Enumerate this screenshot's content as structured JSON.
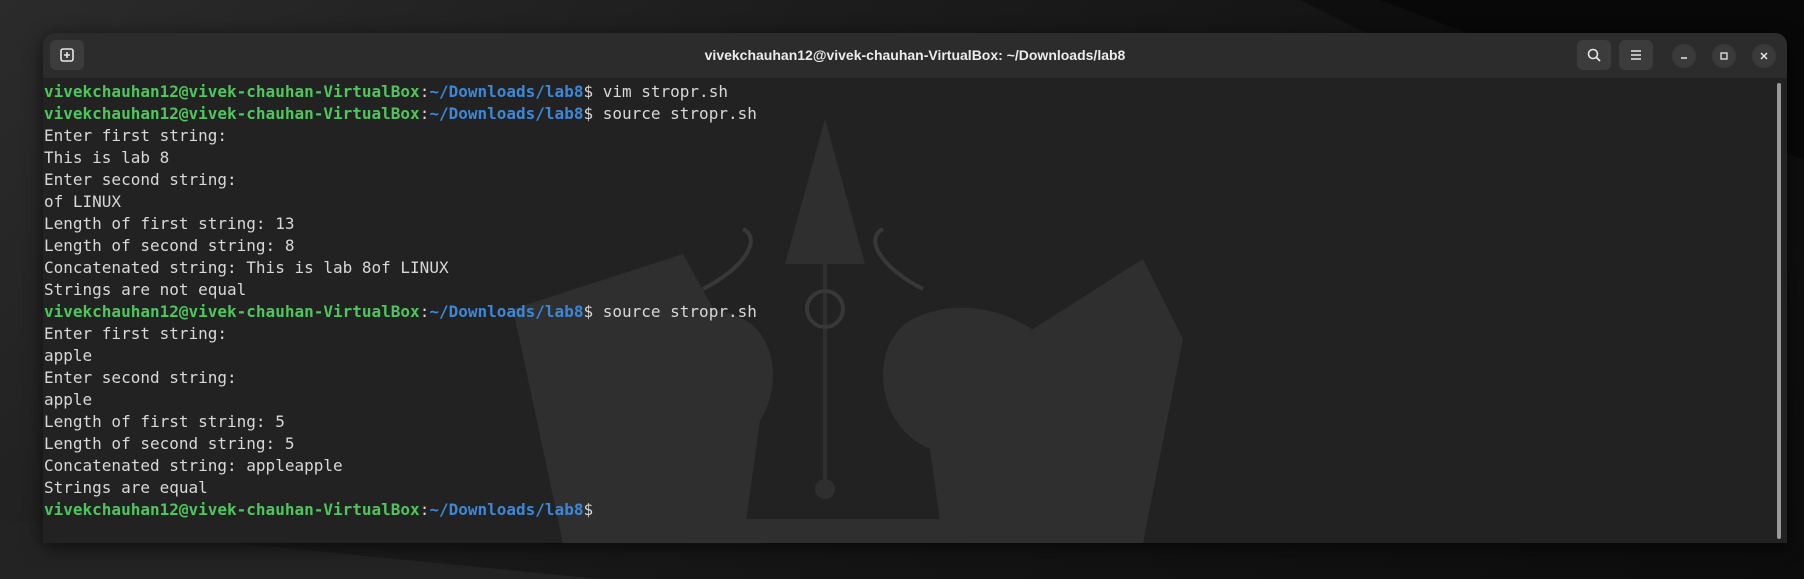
{
  "window": {
    "title": "vivekchauhan12@vivek-chauhan-VirtualBox: ~/Downloads/lab8"
  },
  "toolbar": {
    "new_tab_icon": "new-tab-icon",
    "search_icon": "search-icon",
    "menu_icon": "hamburger-menu-icon"
  },
  "window_controls": [
    "minimize-icon",
    "maximize-icon",
    "close-icon"
  ],
  "prompt": {
    "user_host": "vivekchauhan12@vivek-chauhan-VirtualBox",
    "separator": ":",
    "path": "~/Downloads/lab8",
    "symbol": "$"
  },
  "colors": {
    "prompt_user": "#4fc65d",
    "prompt_path": "#3d87d8",
    "text": "#d8d8d8",
    "background": "#222222"
  },
  "lines": [
    {
      "type": "prompt",
      "command": " vim stropr.sh"
    },
    {
      "type": "prompt",
      "command": " source stropr.sh"
    },
    {
      "type": "output",
      "text": "Enter first string:"
    },
    {
      "type": "output",
      "text": "This is lab 8"
    },
    {
      "type": "output",
      "text": "Enter second string:"
    },
    {
      "type": "output",
      "text": "of LINUX"
    },
    {
      "type": "output",
      "text": "Length of first string: 13"
    },
    {
      "type": "output",
      "text": "Length of second string: 8"
    },
    {
      "type": "output",
      "text": "Concatenated string: This is lab 8of LINUX"
    },
    {
      "type": "output",
      "text": "Strings are not equal"
    },
    {
      "type": "prompt",
      "command": " source stropr.sh"
    },
    {
      "type": "output",
      "text": "Enter first string:"
    },
    {
      "type": "output",
      "text": "apple"
    },
    {
      "type": "output",
      "text": "Enter second string:"
    },
    {
      "type": "output",
      "text": "apple"
    },
    {
      "type": "output",
      "text": "Length of first string: 5"
    },
    {
      "type": "output",
      "text": "Length of second string: 5"
    },
    {
      "type": "output",
      "text": "Concatenated string: appleapple"
    },
    {
      "type": "output",
      "text": "Strings are equal"
    },
    {
      "type": "prompt",
      "command": ""
    }
  ]
}
